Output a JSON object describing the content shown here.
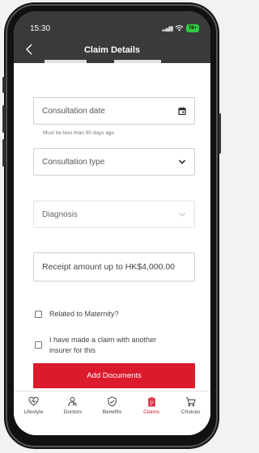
{
  "status_bar": {
    "time": "15:30",
    "battery": "78+"
  },
  "header": {
    "title": "Claim Details"
  },
  "progress": {
    "total_steps": 3,
    "completed_steps": 2
  },
  "form": {
    "consultation_date": {
      "placeholder": "Consultation date",
      "hint": "Must be less than 90 days ago"
    },
    "consultation_type": {
      "placeholder": "Consultation type"
    },
    "diagnosis": {
      "placeholder": "Diagnosis"
    },
    "receipt_amount": {
      "placeholder": "Receipt amount up to HK$4,000.00"
    },
    "maternity_label": "Related to Maternity?",
    "other_insurer_label_line1": "I have made a claim with another",
    "other_insurer_label_line2": "insurer for this",
    "add_documents_label": "Add Documents"
  },
  "tabs": [
    {
      "label": "Lifestyle",
      "icon": "heart-icon"
    },
    {
      "label": "Doctors",
      "icon": "doctor-icon"
    },
    {
      "label": "Benefits",
      "icon": "shield-check-icon"
    },
    {
      "label": "Claims",
      "icon": "clipboard-icon",
      "active": true
    },
    {
      "label": "Choices",
      "icon": "cart-icon"
    }
  ],
  "colors": {
    "accent": "#db1a2c",
    "header": "#3a3a3a"
  }
}
